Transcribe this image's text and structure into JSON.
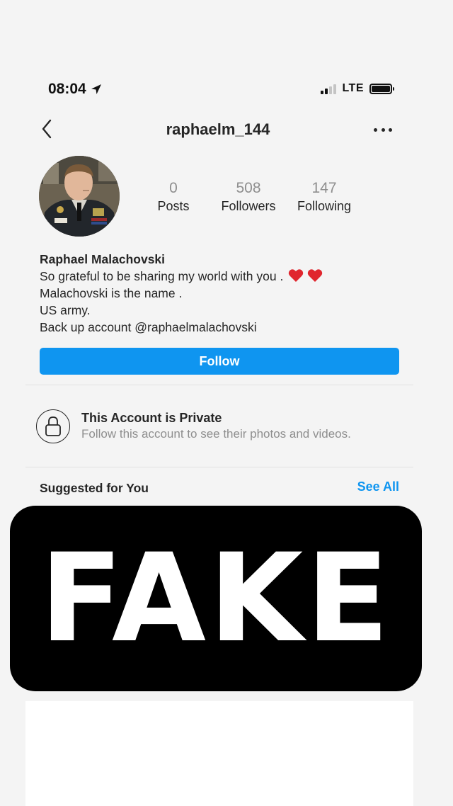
{
  "status_bar": {
    "time": "08:04",
    "network": "LTE",
    "signal_bars_active": 2,
    "signal_bars_total": 4,
    "battery_level": 1.0,
    "icons": [
      "location-arrow-icon",
      "signal-icon",
      "battery-icon"
    ]
  },
  "header": {
    "username": "raphaelm_144",
    "icons": [
      "chevron-left-icon",
      "more-options-icon"
    ]
  },
  "stats": [
    {
      "value": "0",
      "label": "Posts"
    },
    {
      "value": "508",
      "label": "Followers"
    },
    {
      "value": "147",
      "label": "Following"
    }
  ],
  "bio": {
    "name": "Raphael Malachovski",
    "line1": "So grateful to be sharing my world with you .",
    "line2": "Malachovski is the name .",
    "line3": "US army.",
    "line4": "Back up account @raphaelmalachovski"
  },
  "follow_label": "Follow",
  "private": {
    "title": "This Account is Private",
    "subtitle": "Follow this account to see their photos and videos.",
    "icon": "lock-icon"
  },
  "suggested": {
    "title": "Suggested for You",
    "see_all": "See All"
  },
  "overlay_text": "FAKE",
  "colors": {
    "accent": "#0f95f0",
    "heart": "#e0262e",
    "overlay": "#000000",
    "muted": "#8e8e8e"
  }
}
